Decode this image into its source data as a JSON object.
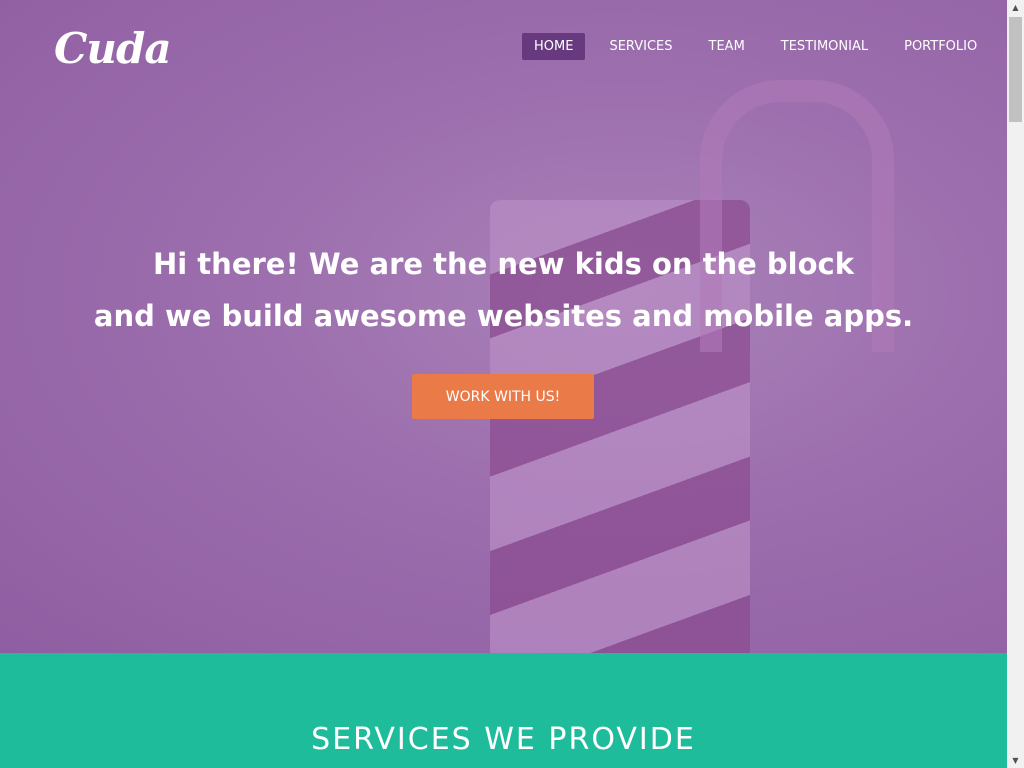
{
  "logo": "Cuda",
  "nav": [
    "HOME",
    "SERVICES",
    "TEAM",
    "TESTIMONIAL",
    "PORTFOLIO"
  ],
  "hero": {
    "line1": "Hi there! We are the new kids on the block",
    "line2": "and we build awesome websites and mobile apps.",
    "cta": "WORK WITH US!"
  },
  "services": {
    "title": "SERVICES WE PROVIDE"
  },
  "colors": {
    "hero": "#9d6fae",
    "accent": "#ea7a48",
    "teal": "#1fbc9c",
    "nav_active": "#673a80"
  }
}
